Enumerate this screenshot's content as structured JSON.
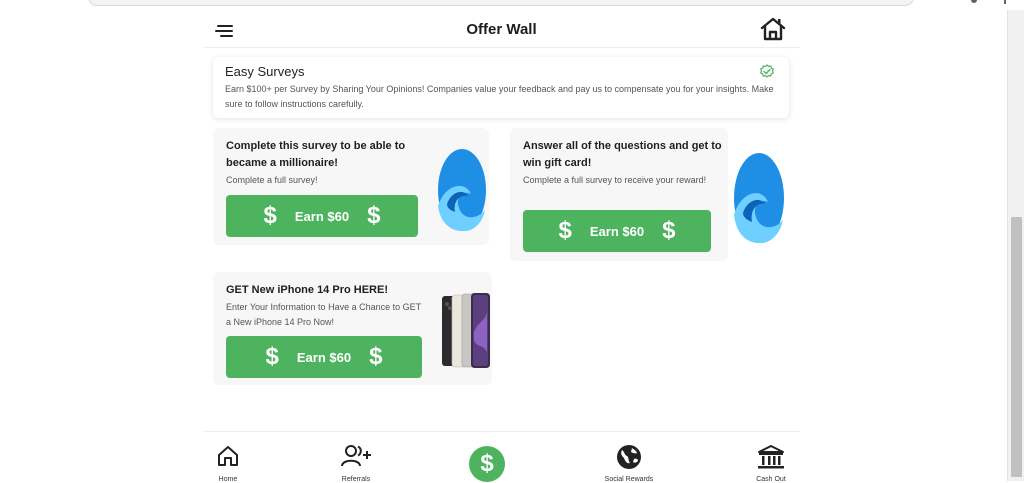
{
  "header": {
    "title": "Offer Wall"
  },
  "info_card": {
    "title": "Easy Surveys",
    "description": "Earn $100+ per Survey by Sharing Your Opinions! Companies value your feedback and pay us to compensate you for your insights. Make sure to follow instructions carefully."
  },
  "offers": [
    {
      "title": "Complete this survey to be able to became a millionaire!",
      "subtitle": "Complete a full survey!",
      "button_label": "Earn $60",
      "image": "wave-logo"
    },
    {
      "title": "Answer all of the questions and get to win gift card!",
      "subtitle": "Complete a full survey to receive your reward!",
      "button_label": "Earn $60",
      "image": "wave-logo"
    },
    {
      "title": "GET New iPhone 14 Pro HERE!",
      "subtitle": "Enter Your Information to Have a Chance to GET a New iPhone 14 Pro Now!",
      "button_label": "Earn $60",
      "image": "iphone-14-pro"
    }
  ],
  "dollar_glyph": "$",
  "bottom_nav": {
    "items": [
      {
        "label": "Home",
        "icon": "home-icon"
      },
      {
        "label": "Referrals",
        "icon": "add-user-icon"
      },
      {
        "label": "",
        "icon": "dollar-icon"
      },
      {
        "label": "Social Rewards",
        "icon": "globe-icon"
      },
      {
        "label": "Cash Out",
        "icon": "bank-icon"
      }
    ]
  },
  "colors": {
    "accent_green": "#4db35e",
    "card_bg": "#f7f7f7",
    "wave_blue": "#1f8fe6"
  }
}
